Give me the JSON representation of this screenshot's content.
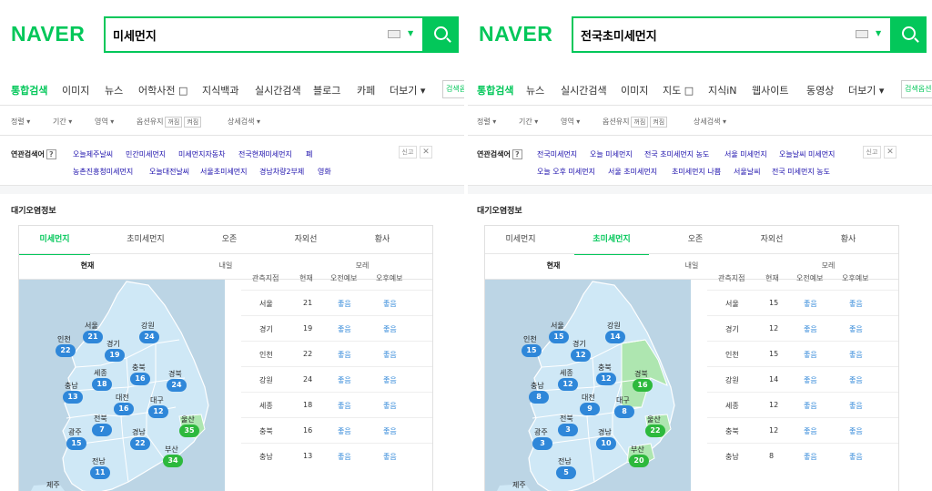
{
  "left": {
    "logo": "NAVER",
    "query": "미세먼지",
    "tabs": [
      {
        "label": "통합검색",
        "active": true
      },
      {
        "label": "이미지"
      },
      {
        "label": "뉴스"
      },
      {
        "label": "어학사전 □"
      },
      {
        "label": "지식백과"
      },
      {
        "label": "실시간검색"
      },
      {
        "label": "블로그"
      },
      {
        "label": "카페"
      },
      {
        "label": "더보기 ▾"
      }
    ],
    "options_btn": "검색옵",
    "options": {
      "sort": "정렬 ▾",
      "period": "기간 ▾",
      "area": "영역 ▾",
      "keep": "옵션유지",
      "toggle_off": "꺼짐",
      "toggle_on": "켜짐",
      "detail": "상세검색 ▾"
    },
    "related": {
      "label": "연관검색어",
      "help": "?",
      "row1": [
        "오늘제주날씨",
        "민간미세먼지",
        "미세먼지자동차",
        "전국현재미세먼지",
        "폐"
      ],
      "row2": [
        "농촌진흥청미세먼지",
        "오늘대전날씨",
        "서울초미세먼지",
        "경남차량2부제",
        "영화"
      ],
      "report": "신고",
      "close": "✕"
    },
    "air": {
      "title": "대기오염정보",
      "tabs": [
        "미세먼지",
        "초미세먼지",
        "오존",
        "자외선",
        "황사"
      ],
      "active_tab": 0,
      "days": [
        "현재",
        "내일",
        "모레"
      ],
      "active_day": 0,
      "headers": [
        "관측지점",
        "현재",
        "오전예보",
        "오후예보"
      ],
      "rows": [
        [
          "서울",
          "21",
          "좋음",
          "좋음"
        ],
        [
          "경기",
          "19",
          "좋음",
          "좋음"
        ],
        [
          "인천",
          "22",
          "좋음",
          "좋음"
        ],
        [
          "강원",
          "24",
          "좋음",
          "좋음"
        ],
        [
          "세종",
          "18",
          "좋음",
          "좋음"
        ],
        [
          "충북",
          "16",
          "좋음",
          "좋음"
        ],
        [
          "충남",
          "13",
          "좋음",
          "좋음"
        ]
      ],
      "map": [
        {
          "city": "서울",
          "value": "21"
        },
        {
          "city": "인천",
          "value": "22"
        },
        {
          "city": "경기",
          "value": "19"
        },
        {
          "city": "강원",
          "value": "24"
        },
        {
          "city": "세종",
          "value": "18"
        },
        {
          "city": "충북",
          "value": "16"
        },
        {
          "city": "충남",
          "value": "13"
        },
        {
          "city": "대전",
          "value": "16"
        },
        {
          "city": "경북",
          "value": "24"
        },
        {
          "city": "대구",
          "value": "12"
        },
        {
          "city": "전북",
          "value": "7"
        },
        {
          "city": "울산",
          "value": "35"
        },
        {
          "city": "광주",
          "value": "15"
        },
        {
          "city": "경남",
          "value": "22"
        },
        {
          "city": "부산",
          "value": "34"
        },
        {
          "city": "전남",
          "value": "11"
        },
        {
          "city": "제주",
          "value": ""
        }
      ]
    }
  },
  "right": {
    "logo": "NAVER",
    "query": "전국초미세먼지",
    "tabs": [
      {
        "label": "통합검색",
        "active": true
      },
      {
        "label": "뉴스"
      },
      {
        "label": "실시간검색"
      },
      {
        "label": "이미지"
      },
      {
        "label": "지도 □"
      },
      {
        "label": "지식iN"
      },
      {
        "label": "웹사이트"
      },
      {
        "label": "동영상"
      },
      {
        "label": "더보기 ▾"
      }
    ],
    "options_btn": "검색옵션",
    "options": {
      "sort": "정렬 ▾",
      "period": "기간 ▾",
      "area": "영역 ▾",
      "keep": "옵션유지",
      "toggle_off": "꺼짐",
      "toggle_on": "켜짐",
      "detail": "상세검색 ▾"
    },
    "related": {
      "label": "연관검색어",
      "help": "?",
      "row1": [
        "전국미세먼지",
        "오늘 미세먼지",
        "전국 초미세먼지 농도",
        "서울 미세먼지",
        "오늘날씨 미세먼지"
      ],
      "row2": [
        "오늘 오후 미세먼지",
        "서울 초미세먼지",
        "초미세먼지 나쁨",
        "서울날씨",
        "전국 미세먼지 농도"
      ],
      "report": "신고",
      "close": "✕"
    },
    "air": {
      "title": "대기오염정보",
      "tabs": [
        "미세먼지",
        "초미세먼지",
        "오존",
        "자외선",
        "황사"
      ],
      "active_tab": 1,
      "days": [
        "현재",
        "내일",
        "모레"
      ],
      "active_day": 0,
      "headers": [
        "관측지점",
        "현재",
        "오전예보",
        "오후예보"
      ],
      "rows": [
        [
          "서울",
          "15",
          "좋음",
          "좋음"
        ],
        [
          "경기",
          "12",
          "좋음",
          "좋음"
        ],
        [
          "인천",
          "15",
          "좋음",
          "좋음"
        ],
        [
          "강원",
          "14",
          "좋음",
          "좋음"
        ],
        [
          "세종",
          "12",
          "좋음",
          "좋음"
        ],
        [
          "충북",
          "12",
          "좋음",
          "좋음"
        ],
        [
          "충남",
          "8",
          "좋음",
          "좋음"
        ]
      ],
      "map": [
        {
          "city": "서울",
          "value": "15"
        },
        {
          "city": "인천",
          "value": "15"
        },
        {
          "city": "경기",
          "value": "12"
        },
        {
          "city": "강원",
          "value": "14"
        },
        {
          "city": "세종",
          "value": "12"
        },
        {
          "city": "충북",
          "value": "12"
        },
        {
          "city": "충남",
          "value": "8"
        },
        {
          "city": "대전",
          "value": "9"
        },
        {
          "city": "경북",
          "value": "16"
        },
        {
          "city": "대구",
          "value": "8"
        },
        {
          "city": "전북",
          "value": "3"
        },
        {
          "city": "울산",
          "value": "22"
        },
        {
          "city": "광주",
          "value": "3"
        },
        {
          "city": "경남",
          "value": "10"
        },
        {
          "city": "부산",
          "value": "20"
        },
        {
          "city": "전남",
          "value": "5"
        },
        {
          "city": "제주",
          "value": ""
        }
      ]
    }
  },
  "colors": {
    "brand": "#03c75a",
    "good": "#2f87d9",
    "high": "#2db93d",
    "map_sea": "#bcd5e5",
    "map_land": "#cfe8f6"
  }
}
